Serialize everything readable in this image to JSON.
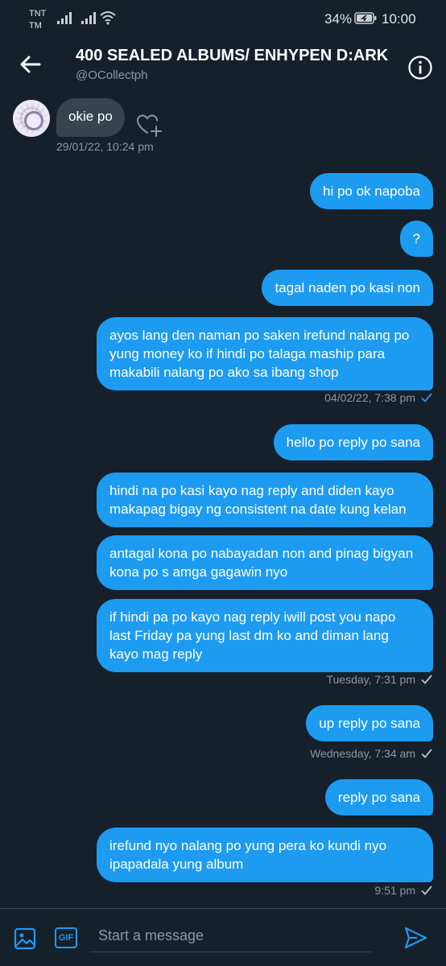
{
  "status_bar": {
    "carrier_line1": "TNT",
    "carrier_line2": "TM",
    "battery_percent": "34%",
    "time": "10:00"
  },
  "header": {
    "title": "400 SEALED ALBUMS/ ENHYPEN D:ARK",
    "handle": "@OCollectph"
  },
  "incoming": {
    "text": "okie po",
    "timestamp": "29/01/22, 10:24 pm"
  },
  "outgoing": [
    {
      "text": "hi po ok napoba"
    },
    {
      "text": "?"
    },
    {
      "text": "tagal naden po kasi non"
    },
    {
      "text": "ayos lang den naman po saken irefund nalang po yung money ko if hindi po talaga maship para makabili nalang po ako sa ibang shop",
      "timestamp": "04/02/22, 7:38 pm"
    },
    {
      "text": "hello po reply po sana"
    },
    {
      "text": "hindi na po kasi kayo nag reply and diden kayo makapag bigay ng consistent na date kung kelan"
    },
    {
      "text": "antagal kona po nabayadan non and pinag bigyan kona po s amga gagawin nyo"
    },
    {
      "text": "if hindi pa po kayo nag reply iwill post you napo last Friday pa yung last dm ko and diman lang kayo mag reply",
      "timestamp": "Tuesday, 7:31 pm"
    },
    {
      "text": "up reply po sana",
      "timestamp": "Wednesday, 7:34 am"
    },
    {
      "text": "reply po sana"
    },
    {
      "text": "irefund nyo nalang po yung pera ko kundi nyo ipapadala yung album",
      "timestamp": "9:51 pm"
    }
  ],
  "composer": {
    "gif_label": "GIF",
    "placeholder": "Start a message"
  },
  "colors": {
    "background": "#15202b",
    "accent": "#1d9bf0",
    "incoming_bubble": "#38444d",
    "secondary_text": "#8899a6"
  },
  "icons": {
    "back": "arrow-left-icon",
    "info": "info-icon",
    "react": "heart-plus-icon",
    "media": "image-icon",
    "send": "send-icon",
    "read": "check-icon"
  }
}
